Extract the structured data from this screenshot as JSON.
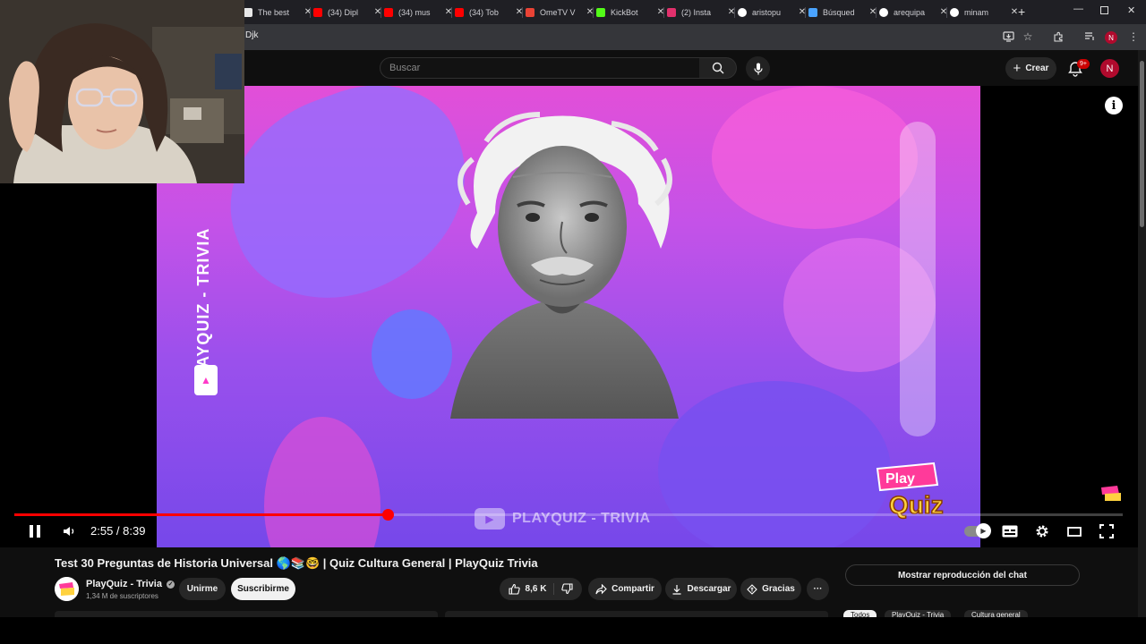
{
  "browser": {
    "tabs": [
      {
        "title": "The best",
        "color": "#e8e8e8"
      },
      {
        "title": "(34) Dipl",
        "color": "#ff0000"
      },
      {
        "title": "(34) mus",
        "color": "#ff0000"
      },
      {
        "title": "(34) Tob",
        "color": "#ff0000"
      },
      {
        "title": "OmeTV V",
        "color": "#ea4335"
      },
      {
        "title": "KickBot",
        "color": "#53fc18"
      },
      {
        "title": "(2) Insta",
        "color": "#e1306c"
      },
      {
        "title": "aristopu",
        "color": "#ffffff"
      },
      {
        "title": "Búsqued",
        "color": "#4aa3ff"
      },
      {
        "title": "arequipa",
        "color": "#ffffff"
      },
      {
        "title": "minam",
        "color": "#ffffff"
      }
    ],
    "new_tab": "+",
    "url": "Djk",
    "profile_initial": "N"
  },
  "youtube": {
    "search_placeholder": "Buscar",
    "create_label": "Crear",
    "notif_badge": "9+",
    "avatar_initial": "N"
  },
  "player": {
    "current_time": "2:55",
    "duration": "8:39",
    "time_display": "2:55 / 8:39",
    "progress_fraction": 0.337,
    "overlay": {
      "vertical_text": "PLAYQUIZ - TRIVIA",
      "watermark_text": "PLAYQUIZ - TRIVIA",
      "logo_line1": "Play",
      "logo_line2": "Quiz",
      "info": "i"
    }
  },
  "video": {
    "title": "Test 30 Preguntas de Historia Universal 🌎📚🤓 | Quiz Cultura General | PlayQuiz Trivia",
    "channel": "PlayQuiz - Trivia",
    "subscribers": "1,34 M de suscriptores",
    "join_label": "Unirme",
    "subscribe_label": "Suscribirme",
    "likes": "8,6 K",
    "share_label": "Compartir",
    "download_label": "Descargar",
    "thanks_label": "Gracias",
    "more_label": "···"
  },
  "sidebar": {
    "chat_replay_label": "Mostrar reproducción del chat",
    "chips": [
      "Todos",
      "PlayQuiz - Trivia",
      "Cultura general"
    ]
  },
  "colors": {
    "accent_red": "#ff0000",
    "yt_bg": "#0f0f0f",
    "frame_pink": "#e24fd8",
    "frame_purple": "#7648ea"
  }
}
